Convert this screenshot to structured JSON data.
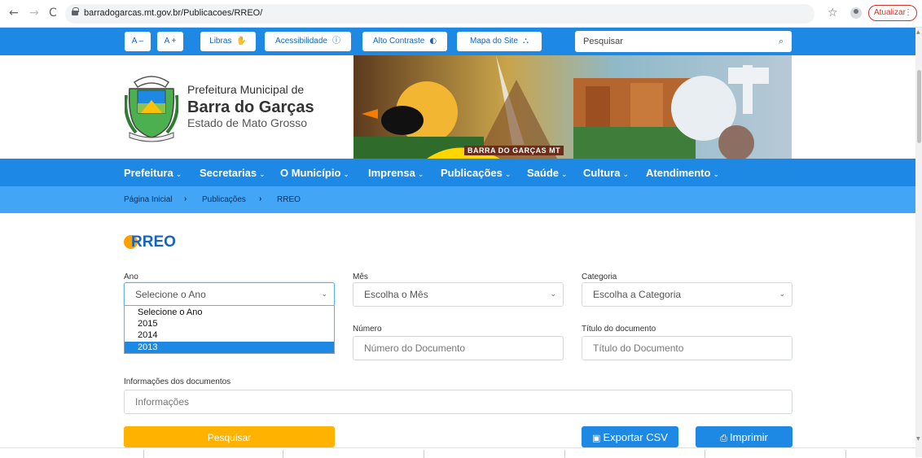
{
  "browser": {
    "back": "←",
    "forward": "→",
    "reload": "C",
    "url": "barradogarcas.mt.gov.br/Publicacoes/RREO/",
    "star": "☆",
    "update_label": "Atualizar",
    "update_menu": "⋮"
  },
  "topbar": {
    "font_decrease": "A –",
    "font_increase": "A +",
    "libras": "Libras",
    "acessibilidade": "Acessibilidade",
    "alto_contraste": "Alto Contraste",
    "mapa_site": "Mapa do Site",
    "search_placeholder": "Pesquisar",
    "icons": {
      "libras": "hand-icon",
      "acessibilidade": "info-icon",
      "alto_contraste": "contrast-icon",
      "mapa_site": "sitemap-icon",
      "search": "search-icon"
    }
  },
  "header": {
    "org_line1": "Prefeitura Municipal de",
    "org_line2": "Barra do Garças",
    "org_line3": "Estado de Mato Grosso",
    "banner_caption": "BARRA DO GARÇAS MT"
  },
  "nav": {
    "items": [
      {
        "label": "Prefeitura"
      },
      {
        "label": "Secretarias"
      },
      {
        "label": "O Município"
      },
      {
        "label": "Imprensa"
      },
      {
        "label": "Publicações"
      },
      {
        "label": "Saúde"
      },
      {
        "label": "Cultura"
      },
      {
        "label": "Atendimento"
      }
    ],
    "chevron": "⌄"
  },
  "breadcrumb": {
    "home": "Página Inicial",
    "publicacoes": "Publicações",
    "current": "RREO",
    "sep": "›"
  },
  "page": {
    "title": "RREO"
  },
  "form": {
    "ano_label": "Ano",
    "ano_value": "Selecione o Ano",
    "ano_options": [
      "Selecione o Ano",
      "2015",
      "2014",
      "2013"
    ],
    "ano_highlighted": "2013",
    "mes_label": "Mês",
    "mes_value": "Escolha o Mês",
    "categoria_label": "Categoria",
    "categoria_value": "Escolha a Categoria",
    "numero_label": "Número",
    "numero_placeholder": "Número do Documento",
    "titulo_label": "Título do documento",
    "titulo_placeholder": "Título do Documento",
    "info_label": "Informações dos documentos",
    "info_placeholder": "Informações",
    "search_button": "Pesquisar",
    "export_button": "Exportar CSV",
    "print_button": "Imprimir"
  },
  "colors": {
    "primary": "#1e88e5",
    "light": "#42a5f5",
    "accent": "#ffb300",
    "title": "#1565c0"
  }
}
